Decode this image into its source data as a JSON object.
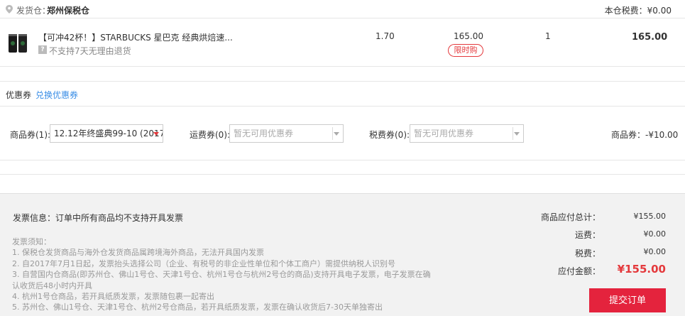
{
  "warehouse": {
    "label": "发货仓：",
    "name": "郑州保税仓",
    "tax_text": "本仓税费：¥0.00"
  },
  "product": {
    "title": "【可冲42杯！】STARBUCKS 星巴克 经典烘焙速...",
    "no_return_icon": "?",
    "no_return": "不支持7天无理由退货",
    "tax": "1.70",
    "price": "165.00",
    "tag": "限时购",
    "qty": "1",
    "subtotal": "165.00"
  },
  "coupon": {
    "title": "优惠券",
    "exchange": "兑换优惠券",
    "goods_label": "商品券(1):",
    "goods_selected": "12.12年终盛典99-10 (2017....",
    "shipping_label": "运费券(0):",
    "shipping_placeholder": "暂无可用优惠券",
    "tax_label": "税费券(0):",
    "tax_placeholder": "暂无可用优惠券",
    "discount": "商品券：-¥10.00"
  },
  "invoice": {
    "info": "发票信息：订单中所有商品均不支持开具发票",
    "notes": [
      "发票须知：",
      "1. 保税仓发货商品与海外仓发货商品属跨境海外商品，无法开具国内发票",
      "2. 自2017年7月1日起，发票抬头选择公司（企业、有税号的非企业性单位和个体工商户）需提供纳税人识别号",
      "3. 自营国内仓商品(即苏州仓、佛山1号仓、天津1号仓、杭州1号仓与杭州2号仓的商品)支持开具电子发票，电子发票在确",
      "认收货后48小时内开具",
      "4. 杭州1号仓商品，若开具纸质发票，发票随包裹一起寄出",
      "5. 苏州仓、佛山1号仓、天津1号仓、杭州2号仓商品，若开具纸质发票，发票在确认收货后7-30天单独寄出"
    ]
  },
  "summary": {
    "goods_total_label": "商品应付总计：",
    "goods_total": "¥155.00",
    "shipping_label": "运费：",
    "shipping": "¥0.00",
    "tax_label": "税费：",
    "tax": "¥0.00",
    "pay_label": "应付金额：",
    "pay": "¥155.00",
    "submit": "提交订单"
  },
  "colors": {
    "accent": "#e4393c",
    "link": "#3a8ee6",
    "submit_bg": "#e4233d"
  },
  "icons": [
    "location-pin-icon",
    "product-thumbnail",
    "question-icon",
    "dropdown-arrow-icon"
  ]
}
